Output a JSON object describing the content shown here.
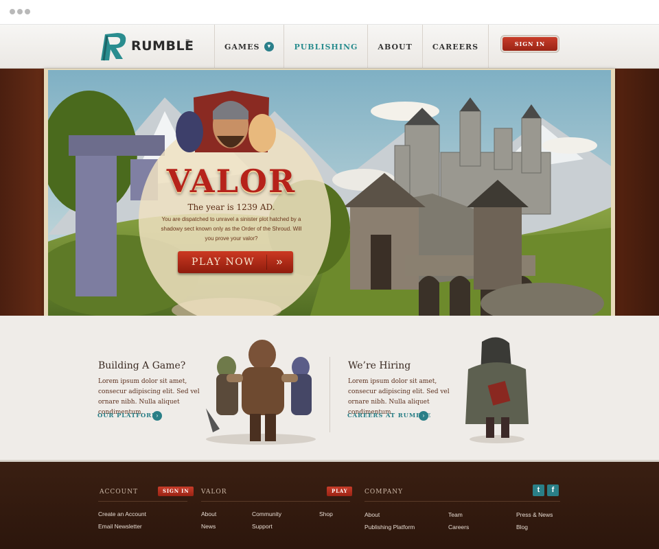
{
  "colors": {
    "brand_teal": "#2a7f87",
    "accent_red": "#b6221a",
    "footer_bg": "#2c160c",
    "page_bg": "#efece8"
  },
  "header": {
    "logo_text": "RUMBLE",
    "logo_tm": "™",
    "nav": [
      {
        "label": "GAMES",
        "icon": "chevron-down-icon"
      },
      {
        "label": "PUBLISHING",
        "active": true
      },
      {
        "label": "ABOUT"
      },
      {
        "label": "CAREERS"
      }
    ],
    "signin_label": "SIGN IN"
  },
  "hero": {
    "title": "VALOR",
    "year": "The year is 1239 AD.",
    "body": "You are dispatched to unravel a sinister plot hatched by a shadowy sect known only as the Order of the Shroud. Will you prove your valor?",
    "play_label": "PLAY NOW",
    "play_icon": "double-chevron-right-icon"
  },
  "promos": {
    "building": {
      "title": "Building A Game?",
      "body": "Lorem ipsum dolor sit amet, consecur adipiscing elit. Sed vel ornare nibh. Nulla aliquet condimentum.",
      "link": "OUR PLATFORM"
    },
    "hiring": {
      "title": "We’re Hiring",
      "body": "Lorem ipsum dolor sit amet, consecur adipiscing elit. Sed vel ornare nibh. Nulla aliquet condimentum.",
      "link": "CAREERS AT RUMBLE"
    }
  },
  "footer": {
    "account": {
      "heading": "ACCOUNT",
      "button": "SIGN IN",
      "links": [
        "Create an Account",
        "Email Newsletter"
      ]
    },
    "valor": {
      "heading": "VALOR",
      "button": "PLAY",
      "links": [
        "About",
        "News",
        "Community",
        "Support",
        "Shop"
      ]
    },
    "company": {
      "heading": "COMPANY",
      "links": [
        "About",
        "Publishing Platform",
        "Team",
        "Careers",
        "Press & News",
        "Blog"
      ],
      "social": [
        {
          "icon": "twitter-icon",
          "color": "#2a7f87"
        },
        {
          "icon": "facebook-icon",
          "color": "#2a7f87"
        }
      ]
    }
  }
}
